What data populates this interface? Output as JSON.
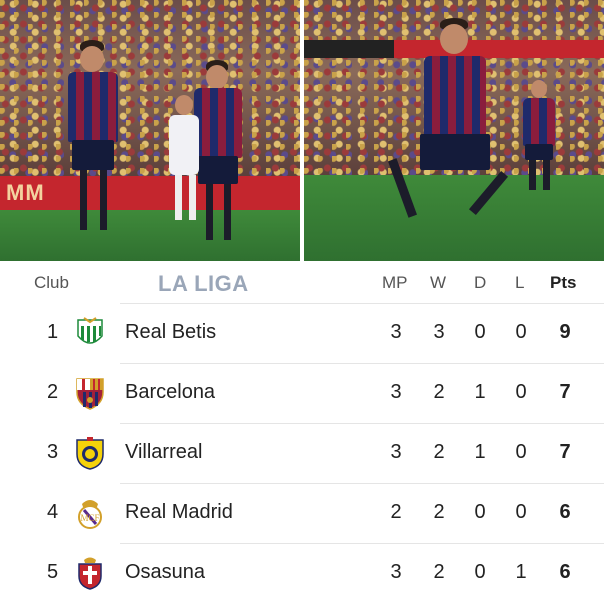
{
  "table": {
    "header": {
      "club": "Club",
      "league": "LA LIGA",
      "mp": "MP",
      "w": "W",
      "d": "D",
      "l": "L",
      "pts": "Pts"
    },
    "rows": [
      {
        "pos": "1",
        "club": "Real Betis",
        "mp": "3",
        "w": "3",
        "d": "0",
        "l": "0",
        "pts": "9",
        "crest_icon": "real-betis-crest-icon"
      },
      {
        "pos": "2",
        "club": "Barcelona",
        "mp": "3",
        "w": "2",
        "d": "1",
        "l": "0",
        "pts": "7",
        "crest_icon": "barcelona-crest-icon"
      },
      {
        "pos": "3",
        "club": "Villarreal",
        "mp": "3",
        "w": "2",
        "d": "1",
        "l": "0",
        "pts": "7",
        "crest_icon": "villarreal-crest-icon"
      },
      {
        "pos": "4",
        "club": "Real Madrid",
        "mp": "2",
        "w": "2",
        "d": "0",
        "l": "0",
        "pts": "6",
        "crest_icon": "real-madrid-crest-icon"
      },
      {
        "pos": "5",
        "club": "Osasuna",
        "mp": "3",
        "w": "2",
        "d": "0",
        "l": "1",
        "pts": "6",
        "crest_icon": "osasuna-crest-icon"
      }
    ]
  },
  "photos": {
    "left_board_text": "MM"
  },
  "colors": {
    "barca_blue": "#1f2a6b",
    "barca_red": "#8a1d3d",
    "pitch_green": "#3f8a3a",
    "league_gray": "#9aa6b8"
  }
}
